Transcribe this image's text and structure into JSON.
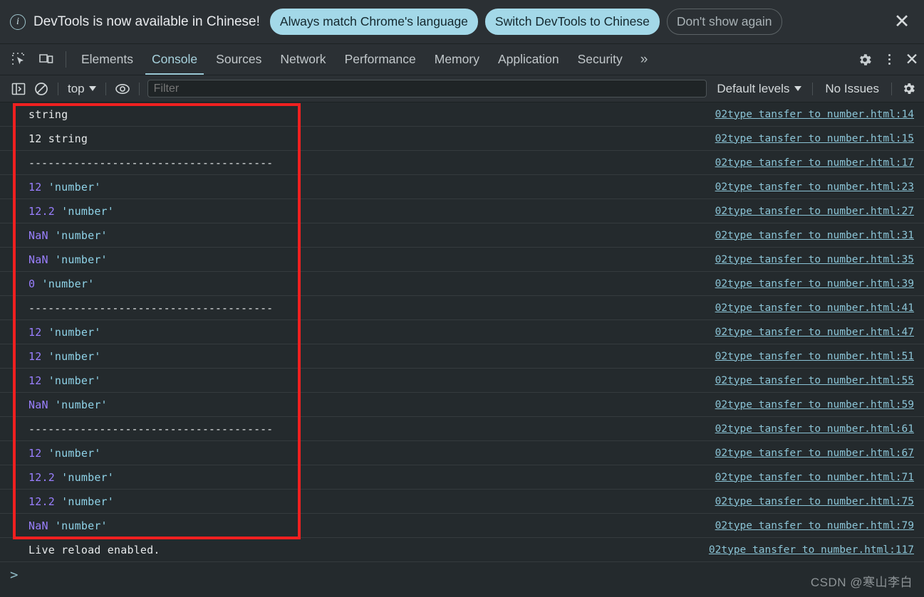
{
  "infobar": {
    "icon": "info-circle-icon",
    "message": "DevTools is now available in Chinese!",
    "buttons": [
      {
        "label": "Always match Chrome's language",
        "style": "primary"
      },
      {
        "label": "Switch DevTools to Chinese",
        "style": "primary"
      },
      {
        "label": "Don't show again",
        "style": "ghost"
      }
    ],
    "close_label": "✕",
    "accent_color": "#a3d8e8"
  },
  "tabbar": {
    "icons": [
      "inspect-element-icon",
      "device-toolbar-icon"
    ],
    "tabs": [
      {
        "label": "Elements",
        "active": false
      },
      {
        "label": "Console",
        "active": true
      },
      {
        "label": "Sources",
        "active": false
      },
      {
        "label": "Network",
        "active": false
      },
      {
        "label": "Performance",
        "active": false
      },
      {
        "label": "Memory",
        "active": false
      },
      {
        "label": "Application",
        "active": false
      },
      {
        "label": "Security",
        "active": false
      }
    ],
    "more_tabs_label": "»",
    "settings_icon": "gear-icon",
    "more_icon": "dots-vertical-icon",
    "close_label": "✕",
    "active_tab_color": "#a8d3de"
  },
  "consolebar": {
    "sidebar_icon": "sidebar-toggle-icon",
    "clear_icon": "clear-console-icon",
    "context": "top",
    "eye_icon": "live-expression-icon",
    "filter_value": "",
    "filter_placeholder": "Filter",
    "levels_label": "Default levels",
    "issues_label": "No Issues",
    "settings_icon": "gear-icon"
  },
  "console": {
    "messages": [
      {
        "tokens": [
          {
            "t": "string",
            "c": "plain"
          }
        ],
        "source": "02type tansfer to number.html:14"
      },
      {
        "tokens": [
          {
            "t": "12 string",
            "c": "plain"
          }
        ],
        "source": "02type tansfer to number.html:15"
      },
      {
        "tokens": [
          {
            "t": "--------------------------------------",
            "c": "rule"
          }
        ],
        "source": "02type tansfer to number.html:17"
      },
      {
        "tokens": [
          {
            "t": "12",
            "c": "num"
          },
          {
            "t": " ",
            "c": "plain"
          },
          {
            "t": "'number'",
            "c": "str"
          }
        ],
        "source": "02type tansfer to number.html:23"
      },
      {
        "tokens": [
          {
            "t": "12.2",
            "c": "num"
          },
          {
            "t": " ",
            "c": "plain"
          },
          {
            "t": "'number'",
            "c": "str"
          }
        ],
        "source": "02type tansfer to number.html:27"
      },
      {
        "tokens": [
          {
            "t": "NaN",
            "c": "num"
          },
          {
            "t": " ",
            "c": "plain"
          },
          {
            "t": "'number'",
            "c": "str"
          }
        ],
        "source": "02type tansfer to number.html:31"
      },
      {
        "tokens": [
          {
            "t": "NaN",
            "c": "num"
          },
          {
            "t": " ",
            "c": "plain"
          },
          {
            "t": "'number'",
            "c": "str"
          }
        ],
        "source": "02type tansfer to number.html:35"
      },
      {
        "tokens": [
          {
            "t": "0",
            "c": "num"
          },
          {
            "t": " ",
            "c": "plain"
          },
          {
            "t": "'number'",
            "c": "str"
          }
        ],
        "source": "02type tansfer to number.html:39"
      },
      {
        "tokens": [
          {
            "t": "--------------------------------------",
            "c": "rule"
          }
        ],
        "source": "02type tansfer to number.html:41"
      },
      {
        "tokens": [
          {
            "t": "12",
            "c": "num"
          },
          {
            "t": " ",
            "c": "plain"
          },
          {
            "t": "'number'",
            "c": "str"
          }
        ],
        "source": "02type tansfer to number.html:47"
      },
      {
        "tokens": [
          {
            "t": "12",
            "c": "num"
          },
          {
            "t": " ",
            "c": "plain"
          },
          {
            "t": "'number'",
            "c": "str"
          }
        ],
        "source": "02type tansfer to number.html:51"
      },
      {
        "tokens": [
          {
            "t": "12",
            "c": "num"
          },
          {
            "t": " ",
            "c": "plain"
          },
          {
            "t": "'number'",
            "c": "str"
          }
        ],
        "source": "02type tansfer to number.html:55"
      },
      {
        "tokens": [
          {
            "t": "NaN",
            "c": "num"
          },
          {
            "t": " ",
            "c": "plain"
          },
          {
            "t": "'number'",
            "c": "str"
          }
        ],
        "source": "02type tansfer to number.html:59"
      },
      {
        "tokens": [
          {
            "t": "--------------------------------------",
            "c": "rule"
          }
        ],
        "source": "02type tansfer to number.html:61"
      },
      {
        "tokens": [
          {
            "t": "12",
            "c": "num"
          },
          {
            "t": " ",
            "c": "plain"
          },
          {
            "t": "'number'",
            "c": "str"
          }
        ],
        "source": "02type tansfer to number.html:67"
      },
      {
        "tokens": [
          {
            "t": "12.2",
            "c": "num"
          },
          {
            "t": " ",
            "c": "plain"
          },
          {
            "t": "'number'",
            "c": "str"
          }
        ],
        "source": "02type tansfer to number.html:71"
      },
      {
        "tokens": [
          {
            "t": "12.2",
            "c": "num"
          },
          {
            "t": " ",
            "c": "plain"
          },
          {
            "t": "'number'",
            "c": "str"
          }
        ],
        "source": "02type tansfer to number.html:75"
      },
      {
        "tokens": [
          {
            "t": "NaN",
            "c": "num"
          },
          {
            "t": " ",
            "c": "plain"
          },
          {
            "t": "'number'",
            "c": "str"
          }
        ],
        "source": "02type tansfer to number.html:79"
      },
      {
        "tokens": [
          {
            "t": "Live reload enabled.",
            "c": "plain"
          }
        ],
        "source": "02type tansfer to number.html:117"
      }
    ],
    "prompt_symbol": ">",
    "highlight_color": "#f02020",
    "number_color": "#9a7fff",
    "string_color": "#8fd3e8"
  },
  "watermark": "CSDN @寒山李白"
}
